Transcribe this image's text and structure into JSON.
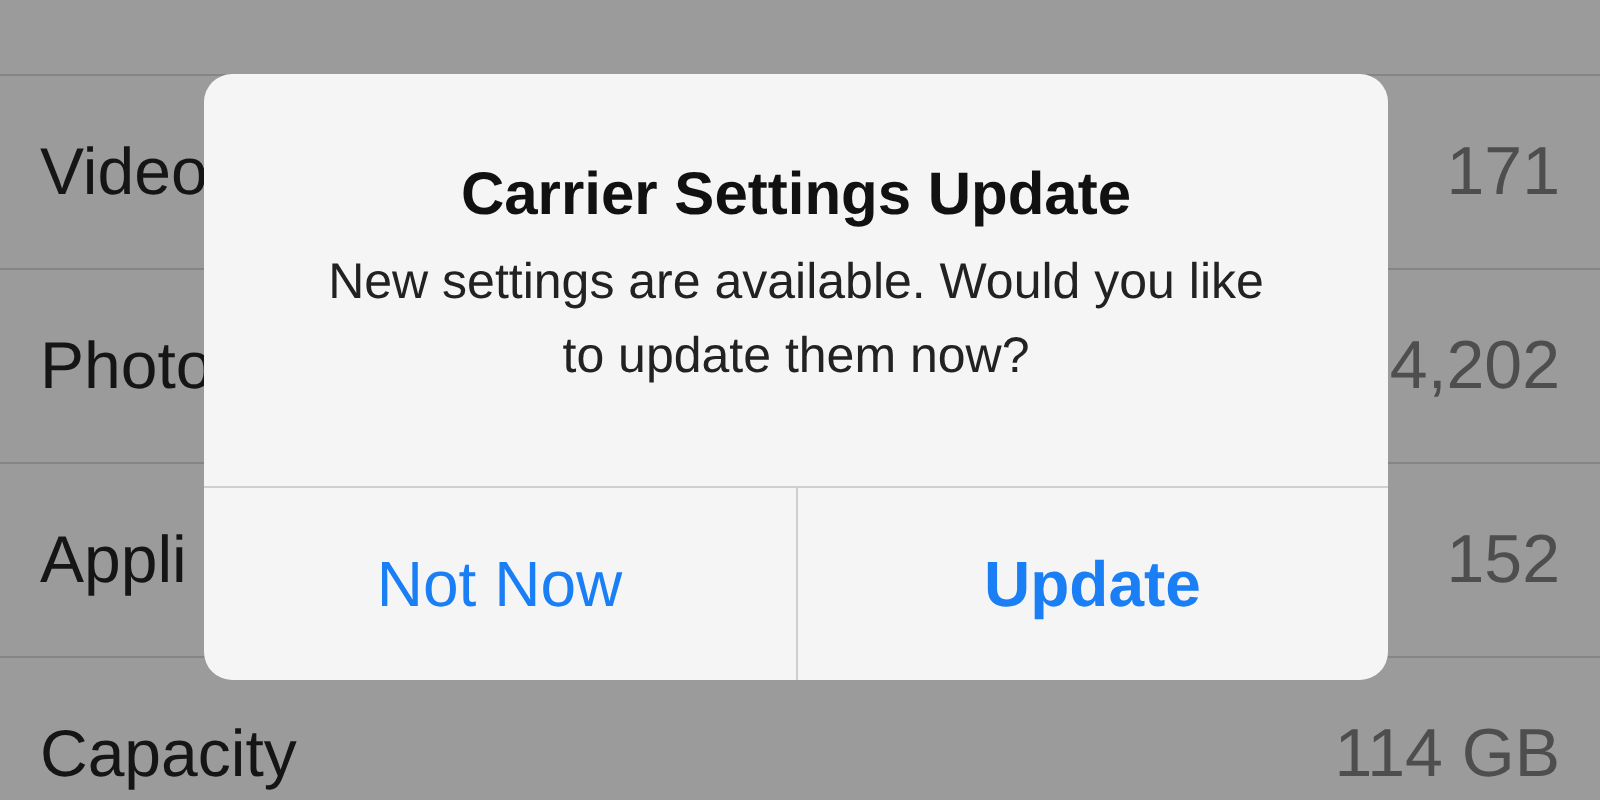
{
  "settings_rows": [
    {},
    {
      "label": "Video",
      "value": "171"
    },
    {
      "label": "Photo",
      "value": "4,202"
    },
    {
      "label": "Appli",
      "value": "152"
    },
    {
      "label": "Capacity",
      "value": "114 GB"
    }
  ],
  "alert": {
    "title": "Carrier Settings Update",
    "message": "New settings are available.  Would you like to update them now?",
    "buttons": [
      {
        "label": "Not Now",
        "preferred": false
      },
      {
        "label": "Update",
        "preferred": true
      }
    ]
  }
}
